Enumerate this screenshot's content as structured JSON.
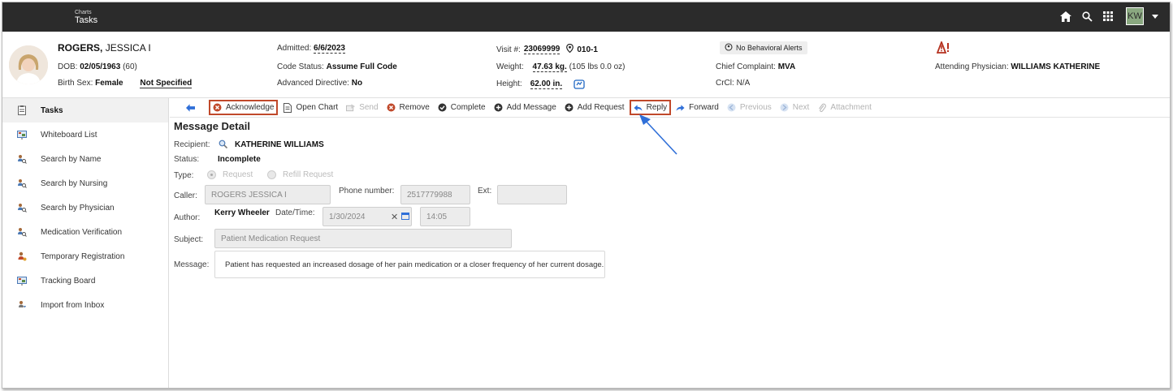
{
  "topbar": {
    "breadcrumb_parent": "Charts",
    "breadcrumb_title": "Tasks",
    "user_initials": "KW"
  },
  "patient": {
    "last_name": "ROGERS,",
    "first_name": "JESSICA I",
    "dob_label": "DOB:",
    "dob_value": "02/05/1963",
    "age": "(60)",
    "birth_sex_label": "Birth Sex:",
    "birth_sex_value": "Female",
    "gender_identity": "Not Specified",
    "admitted_label": "Admitted:",
    "admitted_value": "6/6/2023",
    "code_status_label": "Code Status:",
    "code_status_value": "Assume Full Code",
    "advanced_directive_label": "Advanced Directive:",
    "advanced_directive_value": "No",
    "visit_label": "Visit #:",
    "visit_value": "23069999",
    "room_value": "010-1",
    "weight_label": "Weight:",
    "weight_value": "47.63 kg.",
    "weight_extra": "(105 lbs 0.0 oz)",
    "height_label": "Height:",
    "height_value": "62.00 in.",
    "behavioral_alerts": "No Behavioral Alerts",
    "chief_complaint_label": "Chief Complaint:",
    "chief_complaint_value": "MVA",
    "crcl_label": "CrCl:",
    "crcl_value": "N/A",
    "attending_label": "Attending Physician:",
    "attending_value": "WILLIAMS KATHERINE"
  },
  "sidebar": {
    "items": [
      {
        "label": "Tasks",
        "icon": "tasks-icon"
      },
      {
        "label": "Whiteboard List",
        "icon": "whiteboard-icon"
      },
      {
        "label": "Search by Name",
        "icon": "search-people-icon"
      },
      {
        "label": "Search by Nursing",
        "icon": "search-people-icon"
      },
      {
        "label": "Search by Physician",
        "icon": "search-people-icon"
      },
      {
        "label": "Medication Verification",
        "icon": "search-people-icon"
      },
      {
        "label": "Temporary Registration",
        "icon": "registration-icon"
      },
      {
        "label": "Tracking Board",
        "icon": "tracking-board-icon"
      },
      {
        "label": "Import from Inbox",
        "icon": "import-icon"
      }
    ]
  },
  "toolbar": {
    "acknowledge": "Acknowledge",
    "open_chart": "Open Chart",
    "send": "Send",
    "remove": "Remove",
    "complete": "Complete",
    "add_message": "Add Message",
    "add_request": "Add Request",
    "reply": "Reply",
    "forward": "Forward",
    "previous": "Previous",
    "next": "Next",
    "attachment": "Attachment"
  },
  "message": {
    "title": "Message Detail",
    "recipient_label": "Recipient:",
    "recipient_value": "KATHERINE WILLIAMS",
    "status_label": "Status:",
    "status_value": "Incomplete",
    "type_label": "Type:",
    "type_option_request": "Request",
    "type_option_refill": "Refill Request",
    "caller_label": "Caller:",
    "caller_value": "ROGERS JESSICA I",
    "phone_label": "Phone number:",
    "phone_value": "2517779988",
    "ext_label": "Ext:",
    "ext_value": "",
    "author_label": "Author:",
    "author_value": "Kerry Wheeler",
    "datetime_label": "Date/Time:",
    "date_value": "1/30/2024",
    "time_value": "14:05",
    "subject_label": "Subject:",
    "subject_value": "Patient Medication Request",
    "message_label": "Message:",
    "message_value": "Patient has requested an increased dosage of her pain medication or a closer frequency of her current dosage."
  },
  "colors": {
    "topbar_bg": "#2b2b2b",
    "highlight_border": "#c0492b",
    "annotation_arrow": "#2f6fd8",
    "warning_red": "#b5311f"
  }
}
